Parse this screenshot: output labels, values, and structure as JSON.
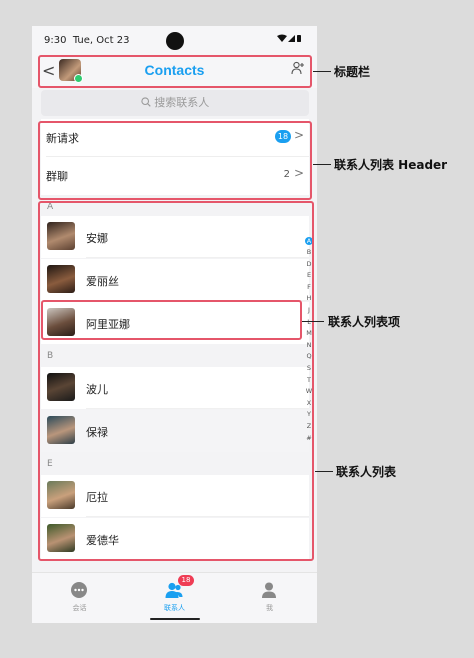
{
  "status": {
    "time": "9:30",
    "date": "Tue, Oct 23"
  },
  "header": {
    "title": "Contacts",
    "back_glyph": "<"
  },
  "search": {
    "placeholder": "搜索联系人"
  },
  "requests": [
    {
      "label": "新请求",
      "badge": "18"
    },
    {
      "label": "群聊",
      "count": "2"
    }
  ],
  "groups": [
    {
      "letter": "A",
      "contacts": [
        {
          "name": "安娜",
          "avatar_color": "#7b5a4a"
        },
        {
          "name": "爱丽丝",
          "avatar_color": "#3f2b22"
        },
        {
          "name": "阿里亚娜",
          "avatar_color": "#6b4e3d"
        }
      ]
    },
    {
      "letter": "B",
      "contacts": [
        {
          "name": "波儿",
          "avatar_color": "#2b2a28"
        },
        {
          "name": "保禄",
          "avatar_color": "#3c5a6a"
        }
      ]
    },
    {
      "letter": "E",
      "contacts": [
        {
          "name": "厄拉",
          "avatar_color": "#5a4a3a"
        },
        {
          "name": "爱德华",
          "avatar_color": "#4a6a3a"
        }
      ]
    }
  ],
  "alphabet": [
    "A",
    "B",
    "D",
    "E",
    "F",
    "H",
    "J",
    "L",
    "M",
    "N",
    "Q",
    "S",
    "T",
    "W",
    "X",
    "Y",
    "Z",
    "#"
  ],
  "tabs": [
    {
      "label": "会话",
      "icon": "chat-icon"
    },
    {
      "label": "联系人",
      "icon": "contacts-icon",
      "badge": "18"
    },
    {
      "label": "我",
      "icon": "person-icon"
    }
  ],
  "annotations": {
    "titlebar": "标题栏",
    "header": "联系人列表 Header",
    "item": "联系人列表项",
    "list": "联系人列表"
  },
  "colors": {
    "accent": "#1a9ff0",
    "annotation_box": "#e5566a",
    "badge_red": "#ef3d55"
  }
}
